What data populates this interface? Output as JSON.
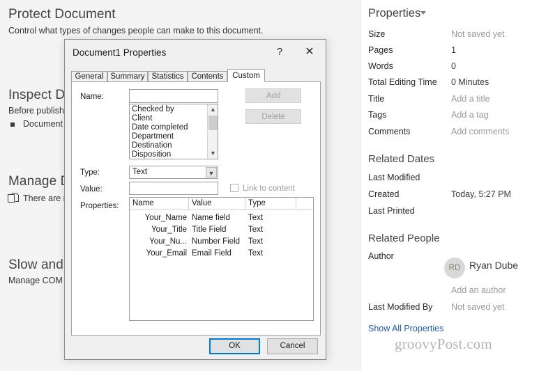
{
  "background": {
    "sections": [
      {
        "title": "Protect Document",
        "subtitle": "Control what types of changes people can make to this document."
      },
      {
        "title": "Inspect Do",
        "subtitle": "Before publishin",
        "bullet": "Document p"
      },
      {
        "title": "Manage D",
        "bullet": "There are n"
      },
      {
        "title": "Slow and D",
        "subtitle": "Manage COM ad"
      }
    ]
  },
  "properties_panel": {
    "heading": "Properties",
    "caret_icon": "chevron-down-icon",
    "rows": [
      {
        "label": "Size",
        "value": "Not saved yet",
        "muted": true
      },
      {
        "label": "Pages",
        "value": "1",
        "muted": false
      },
      {
        "label": "Words",
        "value": "0",
        "muted": false
      },
      {
        "label": "Total Editing Time",
        "value": "0 Minutes",
        "muted": false
      },
      {
        "label": "Title",
        "value": "Add a title",
        "muted": true
      },
      {
        "label": "Tags",
        "value": "Add a tag",
        "muted": true
      },
      {
        "label": "Comments",
        "value": "Add comments",
        "muted": true
      }
    ],
    "related_dates": {
      "heading": "Related Dates",
      "rows": [
        {
          "label": "Last Modified",
          "value": ""
        },
        {
          "label": "Created",
          "value": "Today, 5:27 PM"
        },
        {
          "label": "Last Printed",
          "value": ""
        }
      ]
    },
    "related_people": {
      "heading": "Related People",
      "author_label": "Author",
      "avatar_initials": "RD",
      "author_name": "Ryan Dube",
      "add_author": "Add an author",
      "last_modified_by_label": "Last Modified By",
      "last_modified_by_value": "Not saved yet"
    },
    "show_all": "Show All Properties",
    "watermark": "groovyPost.com"
  },
  "dialog": {
    "title": "Document1 Properties",
    "help_icon": "?",
    "close_icon": "✕",
    "tabs": [
      {
        "label": "General",
        "active": false
      },
      {
        "label": "Summary",
        "active": false
      },
      {
        "label": "Statistics",
        "active": false
      },
      {
        "label": "Contents",
        "active": false
      },
      {
        "label": "Custom",
        "active": true
      }
    ],
    "custom": {
      "name_label": "Name:",
      "name_value": "",
      "name_suggestions": [
        "Checked by",
        "Client",
        "Date completed",
        "Department",
        "Destination",
        "Disposition"
      ],
      "type_label": "Type:",
      "type_value": "Text",
      "type_caret": "chevron-down-icon",
      "value_label": "Value:",
      "value_value": "",
      "link_to_content_label": "Link to content",
      "link_to_content_checked": false,
      "properties_label": "Properties:",
      "add_button": "Add",
      "delete_button": "Delete",
      "grid": {
        "columns": [
          "Name",
          "Value",
          "Type"
        ],
        "rows": [
          {
            "name": "Your_Name",
            "value": "Name field",
            "type": "Text"
          },
          {
            "name": "Your_Title",
            "value": "Title Field",
            "type": "Text"
          },
          {
            "name": "Your_Nu...",
            "value": "Number Field",
            "type": "Text"
          },
          {
            "name": "Your_Email",
            "value": "Email Field",
            "type": "Text"
          }
        ]
      }
    },
    "ok_button": "OK",
    "cancel_button": "Cancel"
  },
  "colors": {
    "accent": "#0078d7",
    "link": "#1f5aa6",
    "panel_bg": "#f4f4f4",
    "dialog_bg": "#f0f0f0"
  }
}
